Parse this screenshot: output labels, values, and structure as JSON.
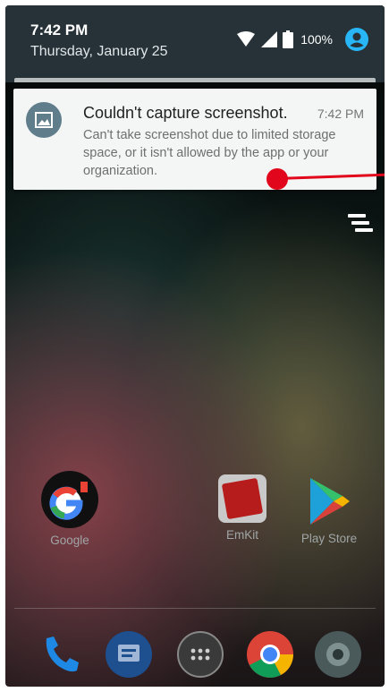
{
  "status_bar": {
    "time": "7:42 PM",
    "date": "Thursday, January 25",
    "battery": "100%",
    "icons": [
      "wifi-icon",
      "cell-signal-icon",
      "battery-icon",
      "account-icon"
    ]
  },
  "notification": {
    "icon": "screenshot-image-icon",
    "title": "Couldn't capture screenshot.",
    "time": "7:42 PM",
    "text": "Can't take screenshot due to limited storage space, or it isn't allowed by the app or your organization."
  },
  "clear_all": {
    "icon": "clear-all-icon"
  },
  "home_apps": [
    {
      "label": "Google",
      "icon": "google-folder-icon"
    },
    {
      "label": "EmKit",
      "icon": "emkit-icon"
    },
    {
      "label": "Play Store",
      "icon": "play-store-icon"
    }
  ],
  "dock": [
    {
      "icon": "phone-icon"
    },
    {
      "icon": "messages-icon"
    },
    {
      "icon": "app-drawer-icon"
    },
    {
      "icon": "chrome-icon"
    },
    {
      "icon": "camera-icon"
    }
  ],
  "colors": {
    "shade_bg": "#263238",
    "notification_bg": "#f4f5f5",
    "accent_blue": "#29b6f6",
    "touch_marker": "#e1061b"
  }
}
